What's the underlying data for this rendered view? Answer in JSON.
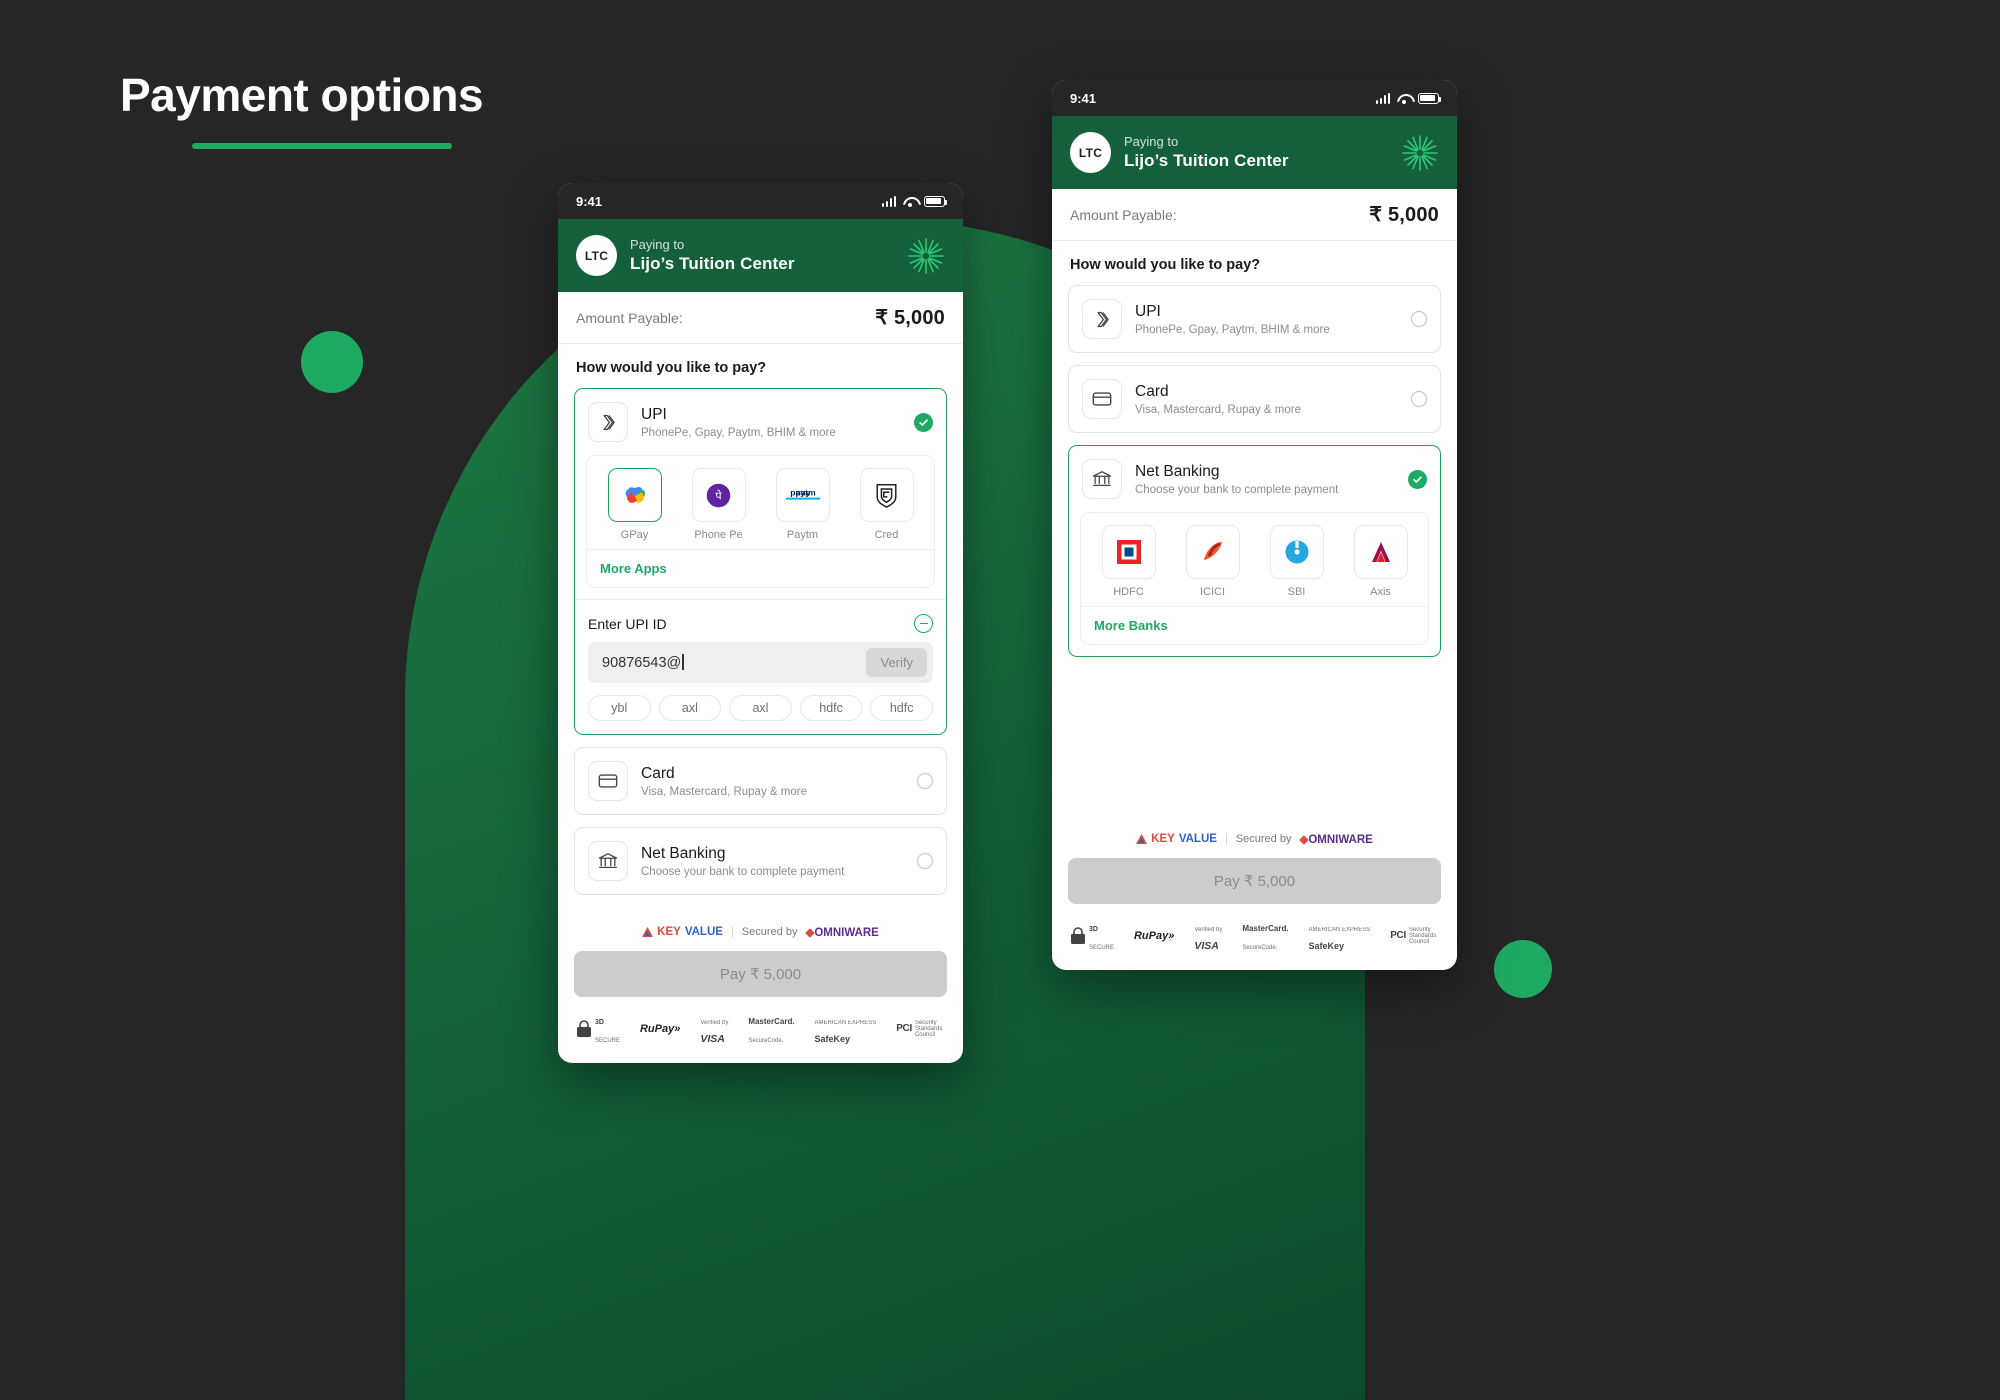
{
  "page": {
    "title": "Payment options",
    "background_color": "#262626",
    "accent_color": "#1faa63",
    "brand_green": "#13603a"
  },
  "phone_a": {
    "name": "upi-selected-screen",
    "status_bar": {
      "time": "9:41",
      "signal_icon": "signal-bars-icon",
      "wifi_icon": "wifi-icon",
      "battery_icon": "battery-icon"
    },
    "merchant": {
      "avatar_initials": "LTC",
      "paying_to_label": "Paying to",
      "merchant_name": "Lijo’s Tuition Center"
    },
    "amount": {
      "label": "Amount Payable:",
      "value": "₹ 5,000"
    },
    "prompt": "How would you like to pay?",
    "options": [
      {
        "id": "upi",
        "icon": "upi-arrows-icon",
        "title": "UPI",
        "subtitle": "PhonePe, Gpay, Paytm, BHIM & more",
        "state": "selected",
        "indicator": "check-circle-icon"
      },
      {
        "id": "card",
        "icon": "credit-card-icon",
        "title": "Card",
        "subtitle": "Visa, Mastercard, Rupay & more",
        "state": "unselected",
        "indicator": "radio-empty-icon"
      },
      {
        "id": "netbanking",
        "icon": "bank-icon",
        "title": "Net Banking",
        "subtitle": "Choose your bank to complete payment",
        "state": "unselected",
        "indicator": "radio-empty-icon"
      }
    ],
    "apps": [
      {
        "label": "GPay",
        "icon": "gpay-icon",
        "selected": true
      },
      {
        "label": "Phone Pe",
        "icon": "phonepe-icon",
        "selected": false
      },
      {
        "label": "Paytm",
        "icon": "paytm-icon",
        "selected": false
      },
      {
        "label": "Cred",
        "icon": "cred-icon",
        "selected": false
      }
    ],
    "more_apps_label": "More Apps",
    "upi_id": {
      "label": "Enter UPI ID",
      "collapse_icon": "minus-circle-icon",
      "value": "90876543@",
      "verify_label": "Verify",
      "suggestions": [
        "ybl",
        "axl",
        "axl",
        "hdfc",
        "hdfc"
      ]
    },
    "footer": {
      "secured_prefix": "KEYVALUE",
      "key_part": "KEY",
      "value_part": "VALUE",
      "separator": "|",
      "secured_by": "Secured by",
      "gateway": "OMNIWARE",
      "pay_button": "Pay ₹ 5,000",
      "badges": [
        {
          "name": "3d-secure-badge",
          "line1": "3D",
          "line2": "SECURE"
        },
        {
          "name": "rupay-badge",
          "line1": "RuPay»",
          "line2": ""
        },
        {
          "name": "verified-by-visa-badge",
          "line1": "Verified by",
          "line2": "VISA"
        },
        {
          "name": "mastercard-securecode-badge",
          "line1": "MasterCard.",
          "line2": "SecureCode."
        },
        {
          "name": "safekey-badge",
          "line1": "AMERICAN EXPRESS",
          "line2": "SafeKey"
        },
        {
          "name": "pci-dss-badge",
          "line1": "PCI",
          "line2": "Security Standards Council"
        }
      ]
    }
  },
  "phone_b": {
    "name": "netbanking-selected-screen",
    "status_bar": {
      "time": "9:41",
      "signal_icon": "signal-bars-icon",
      "wifi_icon": "wifi-icon",
      "battery_icon": "battery-icon"
    },
    "merchant": {
      "avatar_initials": "LTC",
      "paying_to_label": "Paying to",
      "merchant_name": "Lijo’s Tuition Center"
    },
    "amount": {
      "label": "Amount Payable:",
      "value": "₹ 5,000"
    },
    "prompt": "How would you like to pay?",
    "options": [
      {
        "id": "upi",
        "icon": "upi-arrows-icon",
        "title": "UPI",
        "subtitle": "PhonePe, Gpay, Paytm, BHIM & more",
        "state": "unselected",
        "indicator": "radio-empty-icon"
      },
      {
        "id": "card",
        "icon": "credit-card-icon",
        "title": "Card",
        "subtitle": "Visa, Mastercard, Rupay & more",
        "state": "unselected",
        "indicator": "radio-empty-icon"
      },
      {
        "id": "netbanking",
        "icon": "bank-icon",
        "title": "Net Banking",
        "subtitle": "Choose your bank to complete payment",
        "state": "selected",
        "indicator": "check-circle-icon"
      }
    ],
    "banks": [
      {
        "label": "HDFC",
        "icon": "hdfc-icon"
      },
      {
        "label": "ICICI",
        "icon": "icici-icon"
      },
      {
        "label": "SBI",
        "icon": "sbi-icon"
      },
      {
        "label": "Axis",
        "icon": "axis-icon"
      }
    ],
    "more_banks_label": "More Banks",
    "footer": {
      "key_part": "KEY",
      "value_part": "VALUE",
      "separator": "|",
      "secured_by": "Secured by",
      "gateway": "OMNIWARE",
      "pay_button": "Pay ₹ 5,000",
      "badges": [
        {
          "name": "3d-secure-badge",
          "line1": "3D",
          "line2": "SECURE"
        },
        {
          "name": "rupay-badge",
          "line1": "RuPay»",
          "line2": ""
        },
        {
          "name": "verified-by-visa-badge",
          "line1": "Verified by",
          "line2": "VISA"
        },
        {
          "name": "mastercard-securecode-badge",
          "line1": "MasterCard.",
          "line2": "SecureCode."
        },
        {
          "name": "safekey-badge",
          "line1": "AMERICAN EXPRESS",
          "line2": "SafeKey"
        },
        {
          "name": "pci-dss-badge",
          "line1": "PCI",
          "line2": "Security Standards Council"
        }
      ]
    }
  }
}
